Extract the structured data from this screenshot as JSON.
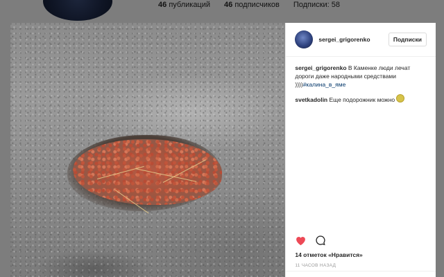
{
  "background": {
    "stats": [
      {
        "count": "46",
        "label": "публикаций"
      },
      {
        "count": "46",
        "label": "подписчиков"
      },
      {
        "count": "",
        "label": "Подписки: 58"
      }
    ]
  },
  "post": {
    "author": "sergei_grigorenko",
    "follow_label": "Подписки",
    "caption": "В Каменке люди лечат дороги даже народными средствами ))))",
    "hashtag": "#калина_в_яме",
    "comments": [
      {
        "user": "svetkadolin",
        "text": "Еще подорожник можно"
      }
    ],
    "likes": "14 отметок «Нравится»",
    "time": "11 часов назад"
  },
  "icons": {
    "like": "heart-icon",
    "comment": "comment-icon",
    "emoji": "grinning-emoji-icon"
  },
  "colors": {
    "like_red": "#ed4956",
    "hashtag": "#003569"
  }
}
